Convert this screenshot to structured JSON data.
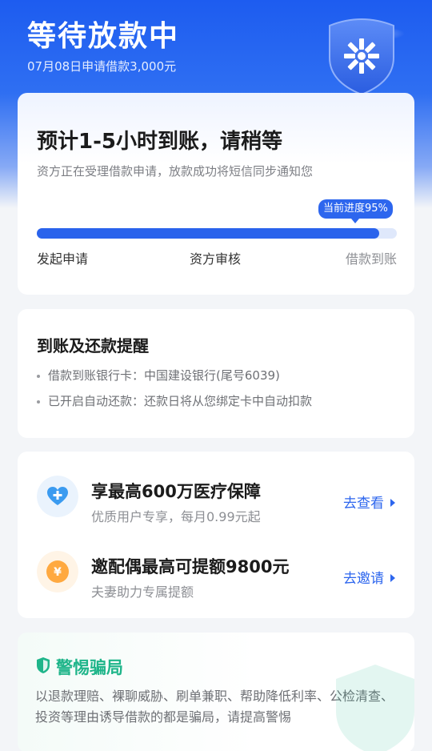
{
  "header": {
    "title": "等待放款中",
    "subtitle": "07月08日申请借款3,000元"
  },
  "progress_card": {
    "title": "预计1-5小时到账，请稍等",
    "description": "资方正在受理借款申请，放款成功将短信同步通知您",
    "badge": "当前进度95%",
    "progress_fraction": 0.95,
    "steps": [
      "发起申请",
      "资方审核",
      "借款到账"
    ]
  },
  "remind_card": {
    "title": "到账及还款提醒",
    "items": [
      "借款到账银行卡：中国建设银行(尾号6039)",
      "已开启自动还款：还款日将从您绑定卡中自动扣款"
    ]
  },
  "offers": [
    {
      "title": "享最高600万医疗保障",
      "subtitle": "优质用户专享，每月0.99元起",
      "action": "去查看",
      "icon": "heart-plus-icon"
    },
    {
      "title": "邀配偶最高可提额9800元",
      "subtitle": "夫妻助力专属提额",
      "action": "去邀请",
      "icon": "yen-coin-icon"
    }
  ],
  "fraud_card": {
    "title": "警惕骗局",
    "text": "以退款理赔、裸聊威胁、刷单兼职、帮助降低利率、公检清查、投资等理由诱导借款的都是骗局，请提高警惕"
  },
  "colors": {
    "brand_blue": "#2d66ee",
    "safe_green": "#1fb58a",
    "coin_orange": "#ffa940"
  }
}
